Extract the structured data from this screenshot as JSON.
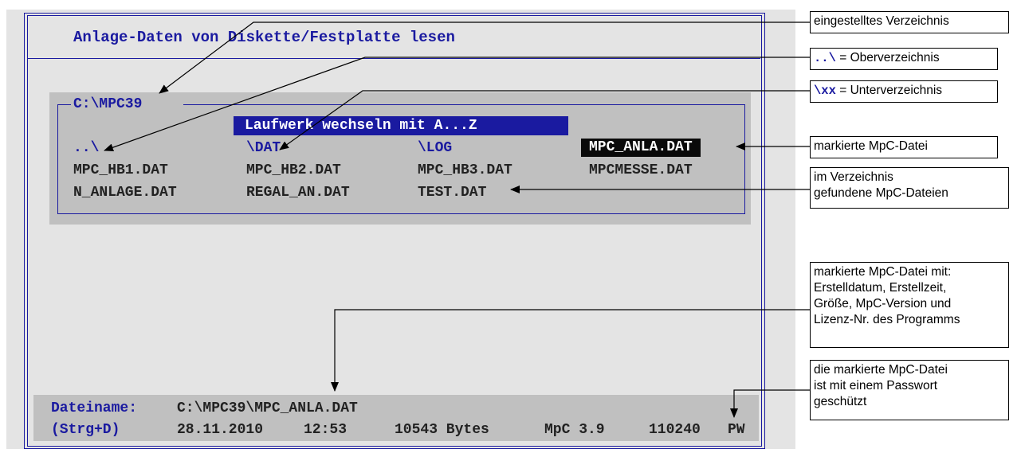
{
  "window": {
    "title": "Anlage-Daten von Diskette/Festplatte lesen"
  },
  "file_panel": {
    "directory": "C:\\MPC39",
    "hint": "Laufwerk wechseln mit A...Z",
    "rows": [
      [
        "..\\",
        "\\DAT",
        "\\LOG",
        "MPC_ANLA.DAT"
      ],
      [
        "MPC_HB1.DAT",
        "MPC_HB2.DAT",
        "MPC_HB3.DAT",
        "MPCMESSE.DAT"
      ],
      [
        "N_ANLAGE.DAT",
        "REGAL_AN.DAT",
        "TEST.DAT"
      ]
    ],
    "selected": "MPC_ANLA.DAT"
  },
  "status": {
    "filename_label": "Dateiname:",
    "filename_value": "C:\\MPC39\\MPC_ANLA.DAT",
    "shortcut": "(Strg+D)",
    "date": "28.11.2010",
    "time": "12:53",
    "size": "10543 Bytes",
    "version": "MpC 3.9",
    "license": "110240",
    "pw": "PW"
  },
  "callouts": {
    "current_dir": "eingestelltes Verzeichnis",
    "parent_code": "..\\",
    "parent_text": "= Oberverzeichnis",
    "sub_code": "\\xx",
    "sub_text": "= Unterverzeichnis",
    "marked_file": "markierte MpC-Datei",
    "found_line1": "im Verzeichnis",
    "found_line2": "gefundene MpC-Dateien",
    "info_line1": "markierte MpC-Datei mit:",
    "info_line2": "Erstelldatum, Erstellzeit,",
    "info_line3": "Größe, MpC-Version und",
    "info_line4": "Lizenz-Nr. des Programms",
    "pw_line1": "die markierte MpC-Datei",
    "pw_line2": "ist mit einem Passwort",
    "pw_line3": "geschützt"
  },
  "colors": {
    "dos_blue": "#1a1aa0",
    "window_bg": "#e4e4e4",
    "panel_bg": "#c0c0c0",
    "selection_bg": "#0a0a0a"
  }
}
